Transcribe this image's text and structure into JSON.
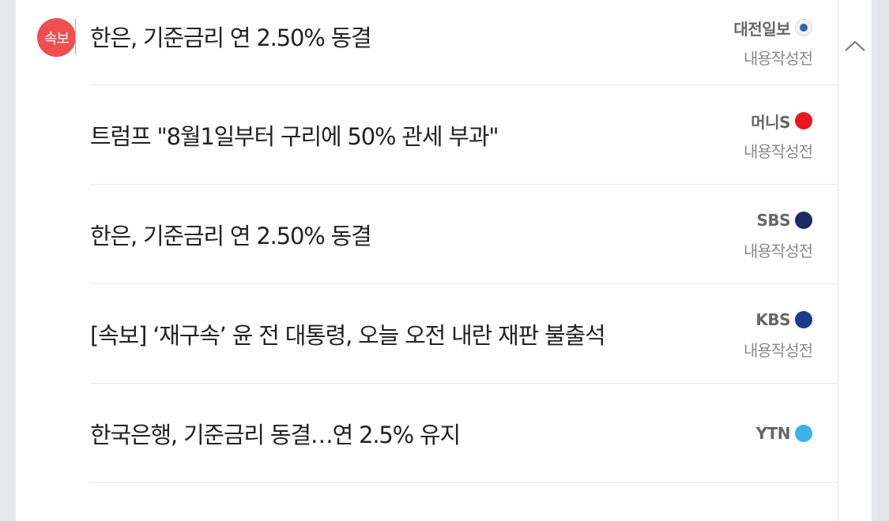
{
  "breaking_badge": "속보",
  "author_label": "내용작성전",
  "news": [
    {
      "headline": "한은, 기준금리 연 2.50% 동결",
      "press": "대전일보",
      "author": "내용작성전",
      "logo": "daejeon"
    },
    {
      "headline": "트럼프 \"8월1일부터 구리에 50% 관세 부과\"",
      "press": "머니S",
      "author": "내용작성전",
      "logo": "moneys"
    },
    {
      "headline": "한은, 기준금리 연 2.50% 동결",
      "press": "SBS",
      "author": "내용작성전",
      "logo": "sbs"
    },
    {
      "headline": "[속보] ‘재구속’ 윤 전 대통령, 오늘 오전 내란 재판 불출석",
      "press": "KBS",
      "author": "내용작성전",
      "logo": "kbs"
    },
    {
      "headline": "한국은행, 기준금리 동결…연 2.5% 유지",
      "press": "YTN",
      "author": "",
      "logo": "ytn"
    }
  ],
  "icons": {
    "collapse": "chevron-up-icon"
  },
  "colors": {
    "badge": "#ef4f4f",
    "moneys": "#e8171c",
    "sbs": "#1c2b64",
    "kbs": "#1e3a8a",
    "ytn": "#39b4e5"
  }
}
